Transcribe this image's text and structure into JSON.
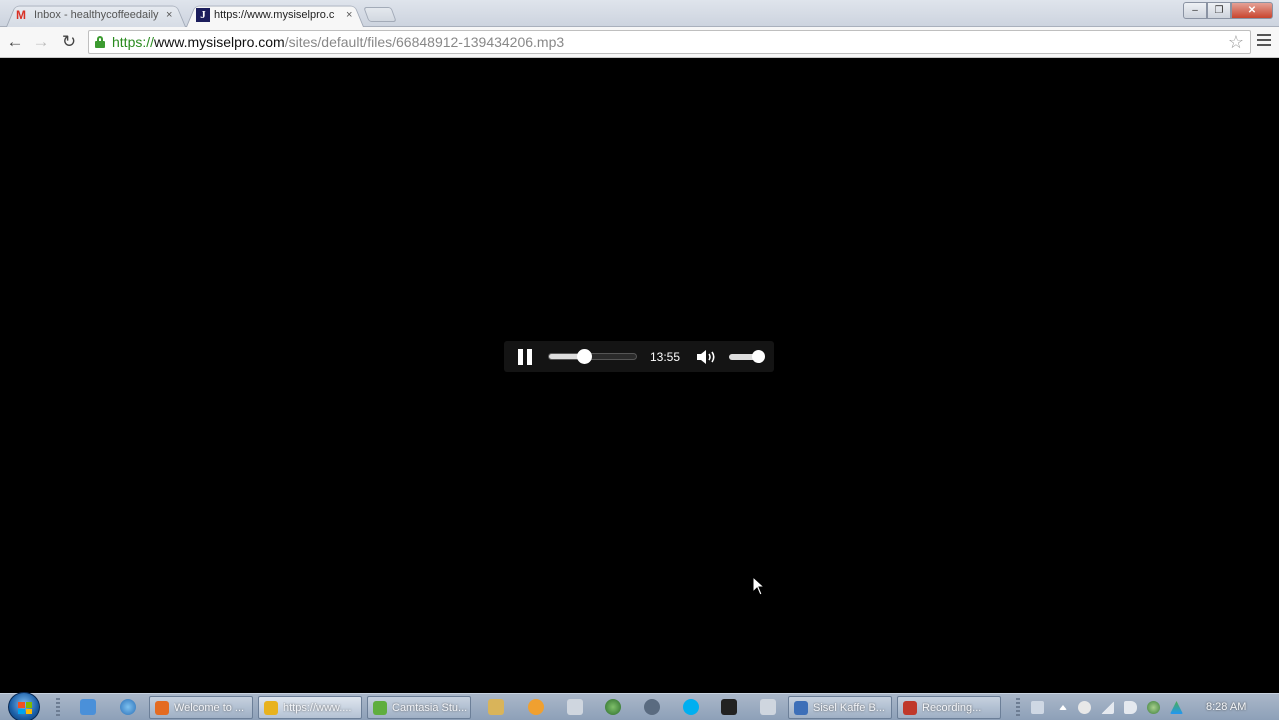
{
  "browser": {
    "tabs": [
      {
        "title": "Inbox - healthycoffeedaily",
        "favicon": "gmail-icon",
        "active": false,
        "close": "×"
      },
      {
        "title": "https://www.mysiselpro.c",
        "favicon": "j-favicon-icon",
        "active": true,
        "close": "×"
      }
    ],
    "window_controls": {
      "minimize": "‒",
      "maximize": "❐",
      "close": "✕"
    },
    "nav": {
      "back": "←",
      "forward": "→",
      "reload": "↻"
    },
    "url": {
      "scheme": "https://",
      "host": "www.mysiselpro.com",
      "path": "/sites/default/files/66848912-139434206.mp3",
      "secure": true
    },
    "bookmark_star": "☆"
  },
  "player": {
    "state": "playing",
    "time": "13:55",
    "progress": 0.4,
    "volume": 1.0
  },
  "taskbar": {
    "windows": [
      {
        "label": "Welcome to ...",
        "icon": "firefox-icon",
        "color": "#e46b21",
        "active": false
      },
      {
        "label": "https://www....",
        "icon": "chrome-icon",
        "color": "#e8b21e",
        "active": true
      },
      {
        "label": "Camtasia Stu...",
        "icon": "camtasia-icon",
        "color": "#5fae3e",
        "active": false
      },
      {
        "label": "Sisel Kaffe B...",
        "icon": "document-icon",
        "color": "#3d6fb8",
        "active": false
      },
      {
        "label": "Recording...",
        "icon": "recording-icon",
        "color": "#c0392b",
        "active": false
      }
    ],
    "clock": "8:28 AM"
  },
  "colors": {
    "page_background": "#000000",
    "secure_green": "#2a8b1f"
  }
}
